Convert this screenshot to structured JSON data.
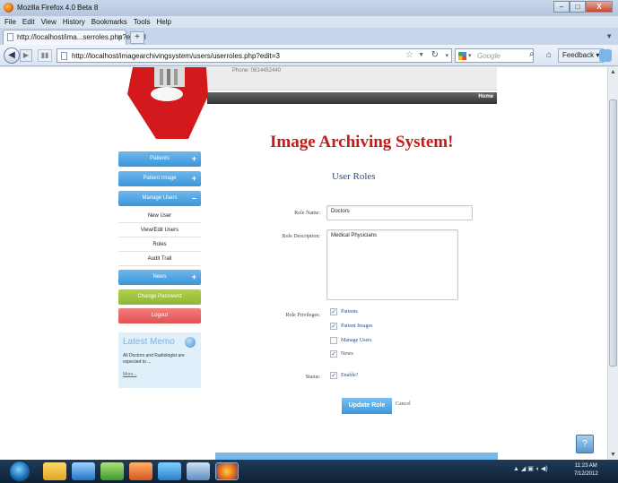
{
  "window": {
    "title": "Mozilla Firefox 4.0 Beta 8",
    "min": "–",
    "max": "□",
    "close": "X"
  },
  "menu": [
    "File",
    "Edit",
    "View",
    "History",
    "Bookmarks",
    "Tools",
    "Help"
  ],
  "tab": {
    "label": "http://localhost/ima...serroles.php?edit=3",
    "close": "×",
    "new": "+"
  },
  "nav": {
    "url": "http://localhost/imagearchivingsystem/users/userroles.php?edit=3",
    "search_placeholder": "Google",
    "feedback": "Feedback ▾",
    "back": "◀",
    "forward": "▶"
  },
  "header": {
    "phone": "Phone: 0814452440",
    "home": "Home"
  },
  "site_title": "Image Archiving System!",
  "section_title": "User Roles",
  "sidebar": {
    "patients": "Patients",
    "patient_image": "Patient Image",
    "manage_users": "Manage Users",
    "sub": [
      "New User",
      "View/Edit Users",
      "Roles",
      "Audit Trail"
    ],
    "news": "News",
    "change_password": "Change Password",
    "logout": "Logout",
    "plus": "+",
    "minus": "–"
  },
  "memo": {
    "title": "Latest Memo",
    "text": "All Doctors and Radiologist are expected to ...",
    "more": "More..."
  },
  "form": {
    "role_name_label": "Role Name:",
    "role_name": "Doctors",
    "role_description_label": "Role Description:",
    "role_description": "Medical Physicians",
    "privileges_label": "Role Privileges:",
    "privileges": [
      {
        "label": "Patients",
        "checked": true
      },
      {
        "label": "Patient Images",
        "checked": true
      },
      {
        "label": "Manage Users",
        "checked": false
      },
      {
        "label": "News",
        "checked": true
      }
    ],
    "status_label": "Status:",
    "status_option": "Enable?",
    "status_checked": true,
    "submit": "Update Role",
    "cancel": "Cancel"
  },
  "taskbar": {
    "time": "11:23 AM",
    "date": "7/12/2012",
    "tray": "▲ ◢ ▣ ◖ ◀)"
  }
}
